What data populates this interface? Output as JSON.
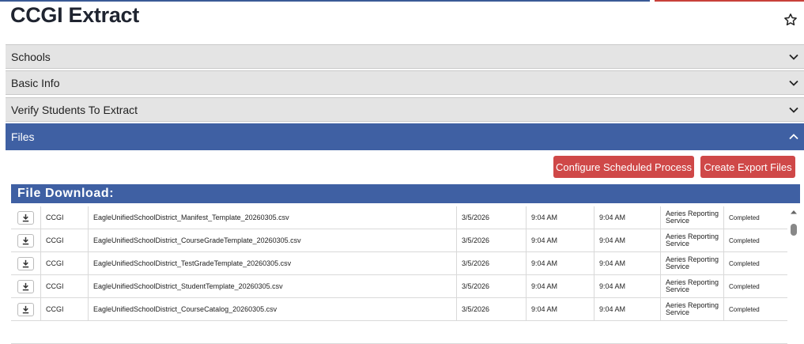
{
  "page": {
    "title": "CCGI Extract"
  },
  "sections": [
    {
      "label": "Schools",
      "expanded": false
    },
    {
      "label": "Basic Info",
      "expanded": false
    },
    {
      "label": "Verify Students To Extract",
      "expanded": false
    },
    {
      "label": "Files",
      "expanded": true
    }
  ],
  "actions": {
    "configure_label": "Configure Scheduled Process",
    "create_label": "Create Export Files"
  },
  "file_download": {
    "title": "File Download:",
    "rows": [
      {
        "type": "CCGI",
        "file": "EagleUnifiedSchoolDistrict_Manifest_Template_20260305.csv",
        "date": "3/5/2026",
        "time1": "9:04 AM",
        "time2": "9:04 AM",
        "service": "Aeries Reporting Service",
        "status": "Completed"
      },
      {
        "type": "CCGI",
        "file": "EagleUnifiedSchoolDistrict_CourseGradeTemplate_20260305.csv",
        "date": "3/5/2026",
        "time1": "9:04 AM",
        "time2": "9:04 AM",
        "service": "Aeries Reporting Service",
        "status": "Completed"
      },
      {
        "type": "CCGI",
        "file": "EagleUnifiedSchoolDistrict_TestGradeTemplate_20260305.csv",
        "date": "3/5/2026",
        "time1": "9:04 AM",
        "time2": "9:04 AM",
        "service": "Aeries Reporting Service",
        "status": "Completed"
      },
      {
        "type": "CCGI",
        "file": "EagleUnifiedSchoolDistrict_StudentTemplate_20260305.csv",
        "date": "3/5/2026",
        "time1": "9:04 AM",
        "time2": "9:04 AM",
        "service": "Aeries Reporting Service",
        "status": "Completed"
      },
      {
        "type": "CCGI",
        "file": "EagleUnifiedSchoolDistrict_CourseCatalog_20260305.csv",
        "date": "3/5/2026",
        "time1": "9:04 AM",
        "time2": "9:04 AM",
        "service": "Aeries Reporting Service",
        "status": "Completed"
      }
    ]
  },
  "icons": {
    "favorite": "star-icon",
    "collapse": "chevron-down-icon",
    "expand": "chevron-up-icon",
    "download": "download-icon"
  },
  "colors": {
    "header_blue": "#3f60a3",
    "button_red": "#cf4848",
    "section_gray": "#e4e4e4"
  }
}
